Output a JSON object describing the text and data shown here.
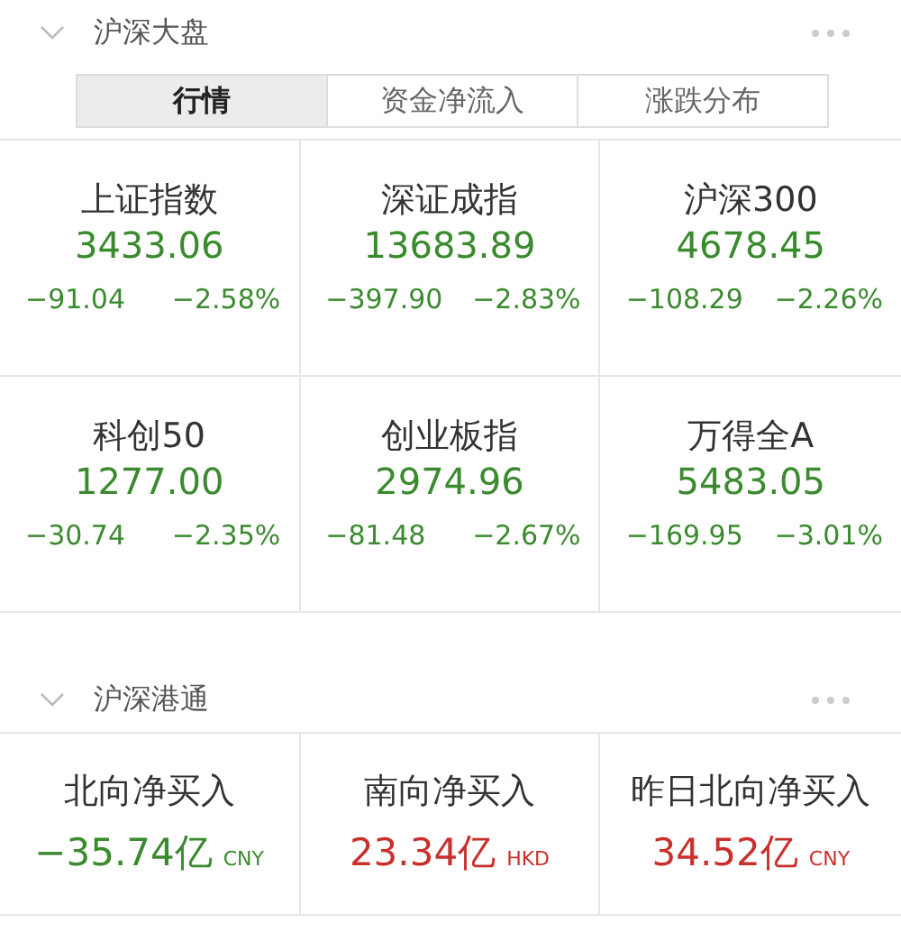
{
  "sections": [
    {
      "title": "沪深大盘",
      "expanded": true,
      "tabs": [
        {
          "label": "行情",
          "selected": true
        },
        {
          "label": "资金净流入",
          "selected": false
        },
        {
          "label": "涨跌分布",
          "selected": false
        }
      ],
      "indices": [
        {
          "name": "上证指数",
          "value": "3433.06",
          "change": "−91.04",
          "percent": "−2.58%",
          "color": "#3a8a2e"
        },
        {
          "name": "深证成指",
          "value": "13683.89",
          "change": "−397.90",
          "percent": "−2.83%",
          "color": "#3a8a2e"
        },
        {
          "name": "沪深300",
          "value": "4678.45",
          "change": "−108.29",
          "percent": "−2.26%",
          "color": "#3a8a2e"
        },
        {
          "name": "科创50",
          "value": "1277.00",
          "change": "−30.74",
          "percent": "−2.35%",
          "color": "#3a8a2e"
        },
        {
          "name": "创业板指",
          "value": "2974.96",
          "change": "−81.48",
          "percent": "−2.67%",
          "color": "#3a8a2e"
        },
        {
          "name": "万得全A",
          "value": "5483.05",
          "change": "−169.95",
          "percent": "−3.01%",
          "color": "#3a8a2e"
        }
      ]
    },
    {
      "title": "沪深港通",
      "expanded": true,
      "flows": [
        {
          "name": "北向净买入",
          "value": "−35.74亿",
          "currency": "CNY",
          "color": "#3a8a2e"
        },
        {
          "name": "南向净买入",
          "value": "23.34亿",
          "currency": "HKD",
          "color": "#c9302c"
        },
        {
          "name": "昨日北向净买入",
          "value": "34.52亿",
          "currency": "CNY",
          "color": "#c9302c"
        }
      ]
    }
  ]
}
